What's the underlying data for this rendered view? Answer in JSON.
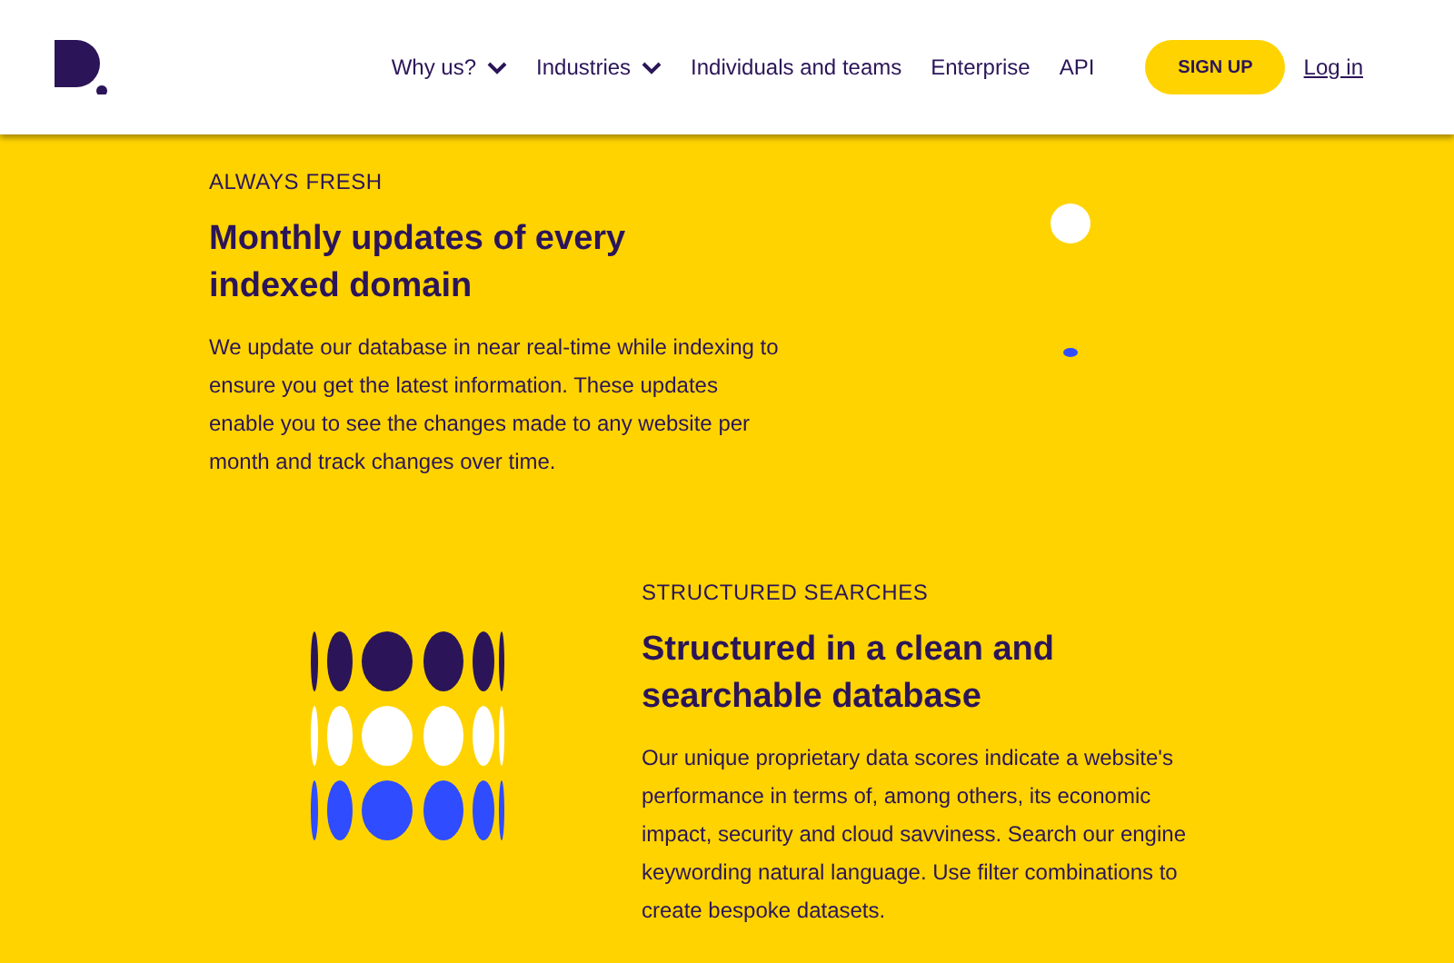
{
  "nav": {
    "items": [
      {
        "label": "Why us?",
        "has_menu": true
      },
      {
        "label": "Industries",
        "has_menu": true
      },
      {
        "label": "Individuals and teams",
        "has_menu": false
      },
      {
        "label": "Enterprise",
        "has_menu": false
      },
      {
        "label": "API",
        "has_menu": false
      }
    ],
    "signup": "SIGN UP",
    "login": "Log in"
  },
  "sections": [
    {
      "eyebrow": "ALWAYS FRESH",
      "title": "Monthly updates of every indexed domain",
      "body": "We update our database in near real-time while indexing to ensure you get the latest information. These updates enable you to see the changes made to any website per month and track changes over time."
    },
    {
      "eyebrow": "STRUCTURED SEARCHES",
      "title": "Structured in a clean and searchable database",
      "body": "Our unique proprietary data scores indicate a website's performance in terms of, among others, its economic impact, security and cloud savviness. Search our engine keywording natural language. Use filter combinations to create bespoke datasets."
    }
  ]
}
